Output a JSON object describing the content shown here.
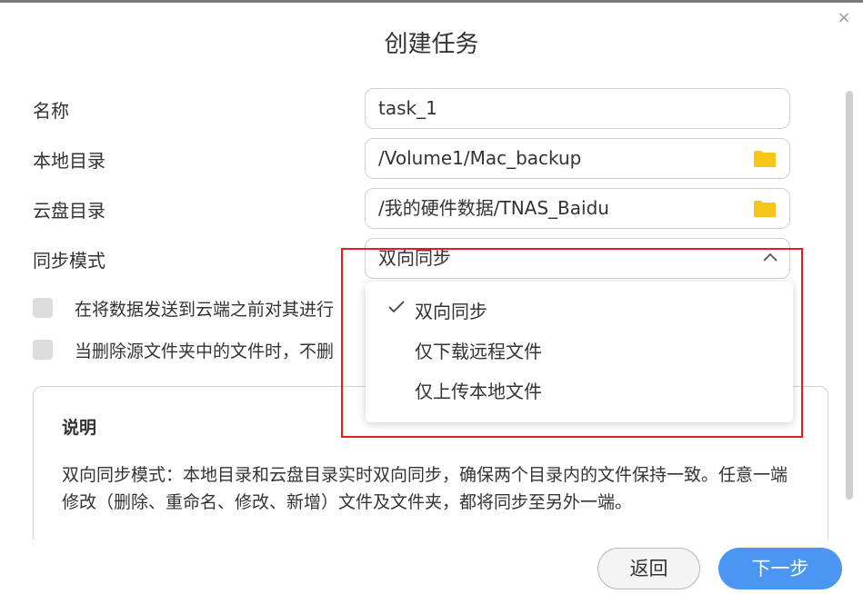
{
  "dialog": {
    "title": "创建任务",
    "close_label": "×"
  },
  "form": {
    "name_label": "名称",
    "name_value": "task_1",
    "local_dir_label": "本地目录",
    "local_dir_value": "/Volume1/Mac_backup",
    "cloud_dir_label": "云盘目录",
    "cloud_dir_value": "/我的硬件数据/TNAS_Baidu",
    "sync_mode_label": "同步模式",
    "sync_mode_value": "双向同步"
  },
  "options": {
    "encrypt_label": "在将数据发送到云端之前对其进行",
    "delete_label": "当删除源文件夹中的文件时，不删"
  },
  "dropdown": {
    "items": [
      {
        "label": "双向同步",
        "selected": true
      },
      {
        "label": "仅下载远程文件",
        "selected": false
      },
      {
        "label": "仅上传本地文件",
        "selected": false
      }
    ]
  },
  "description": {
    "title": "说明",
    "text": "双向同步模式：本地目录和云盘目录实时双向同步，确保两个目录内的文件保持一致。任意一端修改（删除、重命名、修改、新增）文件及文件夹，都将同步至另外一端。"
  },
  "buttons": {
    "back": "返回",
    "next": "下一步"
  },
  "colors": {
    "primary": "#4a96f2",
    "folder": "#f5c518",
    "highlight": "#e02020"
  },
  "icons": {
    "close": "close-icon",
    "folder": "folder-icon",
    "chevron": "chevron-up-icon",
    "check": "check-icon"
  }
}
